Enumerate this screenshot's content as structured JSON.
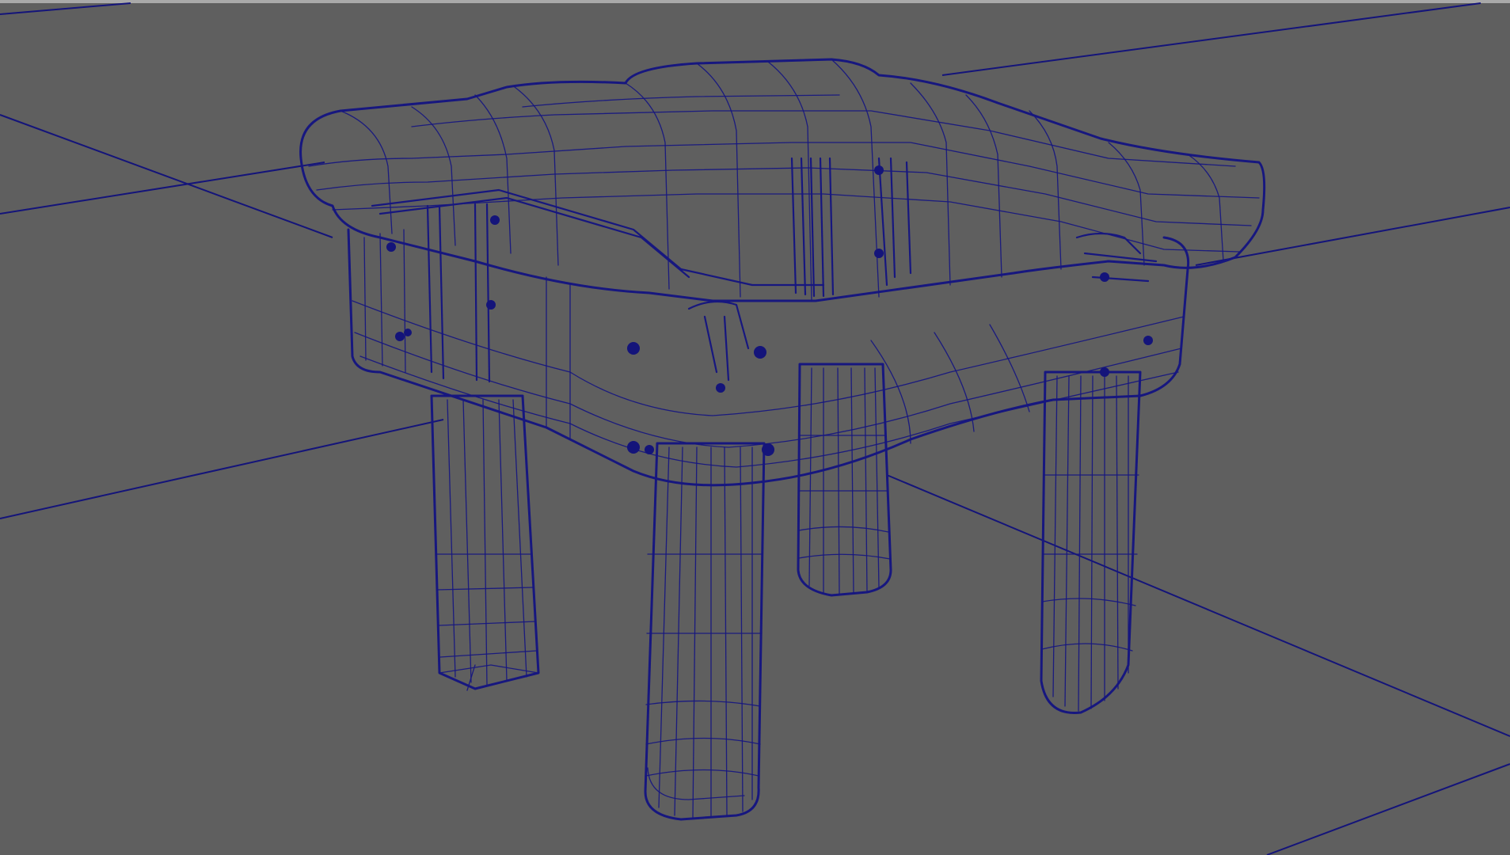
{
  "viewport": {
    "background_color": "#5f5f5f",
    "wireframe_color": "#17177f",
    "grid_color": "#14147a",
    "display_mode": "wireframe",
    "object": "stool"
  }
}
